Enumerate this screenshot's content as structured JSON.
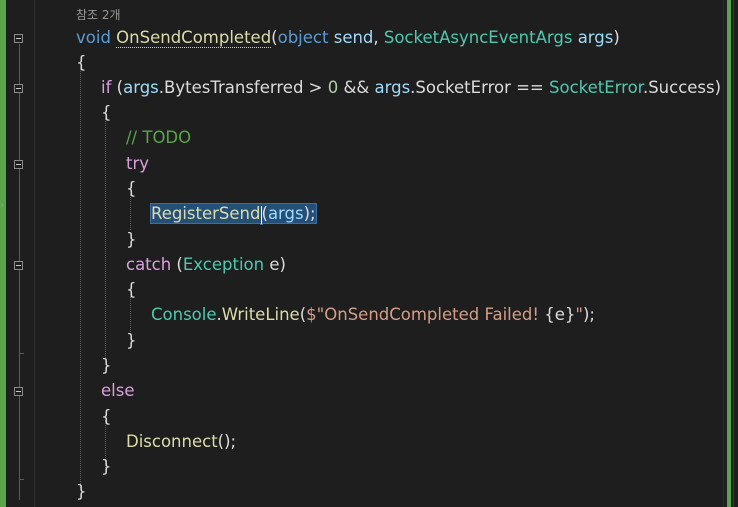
{
  "codelens": {
    "references": "참조 2개"
  },
  "code": {
    "l1_void": "void",
    "l1_name": "OnSendCompleted",
    "l1_open": "(",
    "l1_object": "object",
    "l1_send": "send",
    "l1_comma": ", ",
    "l1_type": "SocketAsyncEventArgs",
    "l1_args": "args",
    "l1_close": ")",
    "brace_open": "{",
    "brace_close": "}",
    "if_kw": "if",
    "if_p1": " (",
    "if_args1": "args",
    "if_bt": ".BytesTransferred > ",
    "if_zero": "0",
    "if_and": " && ",
    "if_args2": "args",
    "if_se": ".SocketError == ",
    "if_type": "SocketError",
    "if_success": ".Success)",
    "comment": "// TODO",
    "try_kw": "try",
    "reg_method": "RegisterSend",
    "reg_open": "(",
    "reg_args": "args",
    "reg_close": ");",
    "catch_kw": "catch",
    "catch_p1": " (",
    "catch_type": "Exception",
    "catch_e": " e)",
    "console_type": "Console",
    "console_dot": ".",
    "console_method": "WriteLine",
    "console_open": "(",
    "console_str1": "$\"OnSendCompleted Failed! ",
    "console_interp": "{e}",
    "console_str2": "\"",
    "console_close": ");",
    "else_kw": "else",
    "disconnect": "Disconnect",
    "disconnect_call": "();"
  },
  "colors": {
    "background": "#1e1e1e",
    "keyword": "#569cd6",
    "control": "#d8a0df",
    "type": "#4ec9b0",
    "parameter": "#9cdcfe",
    "method": "#dcdcaa",
    "string": "#d69d85",
    "comment": "#57a64a",
    "selection": "#264f78",
    "change_marker": "#57a64a"
  },
  "icons": {
    "fold": "collapse-region-icon"
  }
}
